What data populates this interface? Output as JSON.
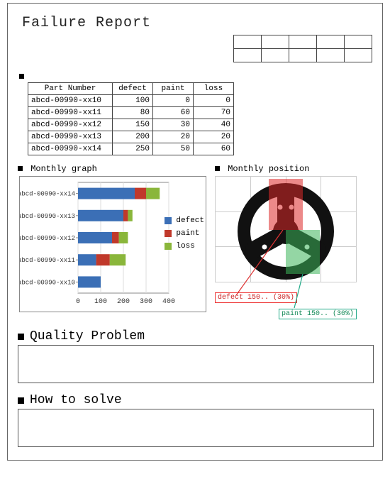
{
  "title": "Failure Report",
  "sections": {
    "table_header": "",
    "monthly_graph": "Monthly graph",
    "monthly_position": "Monthly position",
    "quality_problem": "Quality Problem",
    "how_to_solve": "How to solve"
  },
  "columns": {
    "part": "Part Number",
    "defect": "defect",
    "paint": "paint",
    "loss": "loss"
  },
  "rows": [
    {
      "part": "abcd-00990-xx10",
      "defect": 100,
      "paint": 0,
      "loss": 0
    },
    {
      "part": "abcd-00990-xx11",
      "defect": 80,
      "paint": 60,
      "loss": 70
    },
    {
      "part": "abcd-00990-xx12",
      "defect": 150,
      "paint": 30,
      "loss": 40
    },
    {
      "part": "abcd-00990-xx13",
      "defect": 200,
      "paint": 20,
      "loss": 20
    },
    {
      "part": "abcd-00990-xx14",
      "defect": 250,
      "paint": 50,
      "loss": 60
    }
  ],
  "chart_data": {
    "type": "bar",
    "orientation": "horizontal",
    "stacked": true,
    "categories": [
      "abcd-00990-xx14",
      "abcd-00990-xx13",
      "abcd-00990-xx12",
      "abcd-00990-xx11",
      "abcd-00990-xx10"
    ],
    "series": [
      {
        "name": "defect",
        "color": "#3b6fb6",
        "values": [
          250,
          200,
          150,
          80,
          100
        ]
      },
      {
        "name": "paint",
        "color": "#c0392b",
        "values": [
          50,
          20,
          30,
          60,
          0
        ]
      },
      {
        "name": "loss",
        "color": "#8ab63b",
        "values": [
          60,
          20,
          40,
          70,
          0
        ]
      }
    ],
    "xlabel": "",
    "ylabel": "",
    "xlim": [
      0,
      400
    ],
    "xticks": [
      0,
      100,
      200,
      300,
      400
    ],
    "legend_position": "right"
  },
  "callouts": {
    "defect": "defect 150.. (30%)",
    "paint": "paint 150.. (30%)"
  },
  "colors": {
    "defect": "#3b6fb6",
    "paint": "#c0392b",
    "loss": "#8ab63b",
    "overlay_red": "rgba(220,40,40,0.55)",
    "overlay_green": "rgba(60,180,90,0.55)"
  }
}
